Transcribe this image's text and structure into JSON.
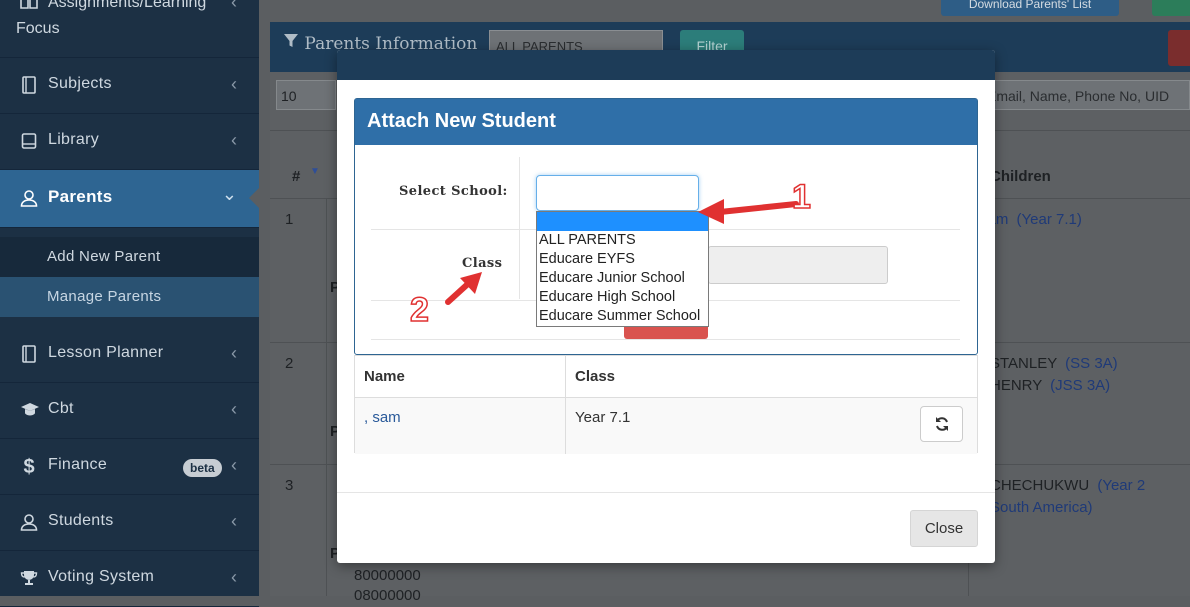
{
  "sidebar": {
    "items": [
      {
        "label": "Assignments/Learning Focus",
        "line1": "Assignments/Learning",
        "line2": "Focus",
        "icon": "book-icon"
      },
      {
        "label": "Subjects",
        "icon": "notebook-icon"
      },
      {
        "label": "Library",
        "icon": "book-square-icon"
      },
      {
        "label": "Parents",
        "icon": "user-icon"
      },
      {
        "label": "Lesson Planner",
        "icon": "notebook-icon"
      },
      {
        "label": "Cbt",
        "icon": "graduation-cap-icon"
      },
      {
        "label": "Finance",
        "icon": "dollar-icon",
        "badge": "beta"
      },
      {
        "label": "Students",
        "icon": "user-icon"
      },
      {
        "label": "Voting System",
        "icon": "trophy-icon"
      }
    ],
    "parents_sub": [
      "Add New Parent",
      "Manage Parents"
    ],
    "chevron": "‹"
  },
  "background": {
    "download_button": "Download Parents' List",
    "panel_title": "Parents Information",
    "school_filter_value": "ALL PARENTS",
    "filter_button": "Filter",
    "page_size": "10",
    "search_placeholder": "Email, Name, Phone No, UID",
    "col_hash": "#",
    "col_children": "Children",
    "rows": [
      {
        "num": "1",
        "children_1": "sam",
        "children_1_class": "(Year 7.1)"
      },
      {
        "num": "2",
        "children_1": "STANLEY",
        "children_1_class": "(SS 3A)",
        "children_2": "HENRY",
        "children_2_class": "(JSS 3A)"
      },
      {
        "num": "3",
        "children_1": "CHECHUKWU",
        "children_1_class": "(Year 2",
        "children_1_cont": "South America)"
      }
    ],
    "phone_lines": [
      "80000000",
      "08000000"
    ]
  },
  "modal": {
    "title": "Attach New Student",
    "select_school_label": "Select School:",
    "class_label": "Class",
    "school_options": [
      "",
      "ALL PARENTS",
      "Educare EYFS",
      "Educare Junior School",
      "Educare High School",
      "Educare Summer School"
    ],
    "table": {
      "headers": [
        "Name",
        "Class"
      ],
      "rows": [
        {
          "name": ", sam",
          "class": "Year 7.1"
        }
      ]
    },
    "close_button": "Close"
  },
  "annotations": {
    "arrow_1_number": "1",
    "arrow_2_number": "2"
  },
  "colors": {
    "sidebar_bg": "#1c3044",
    "active_item": "#2e6592",
    "modal_header": "#2f6fa8",
    "highlight_option": "#1e90ff",
    "annotation_red": "#e03131"
  }
}
